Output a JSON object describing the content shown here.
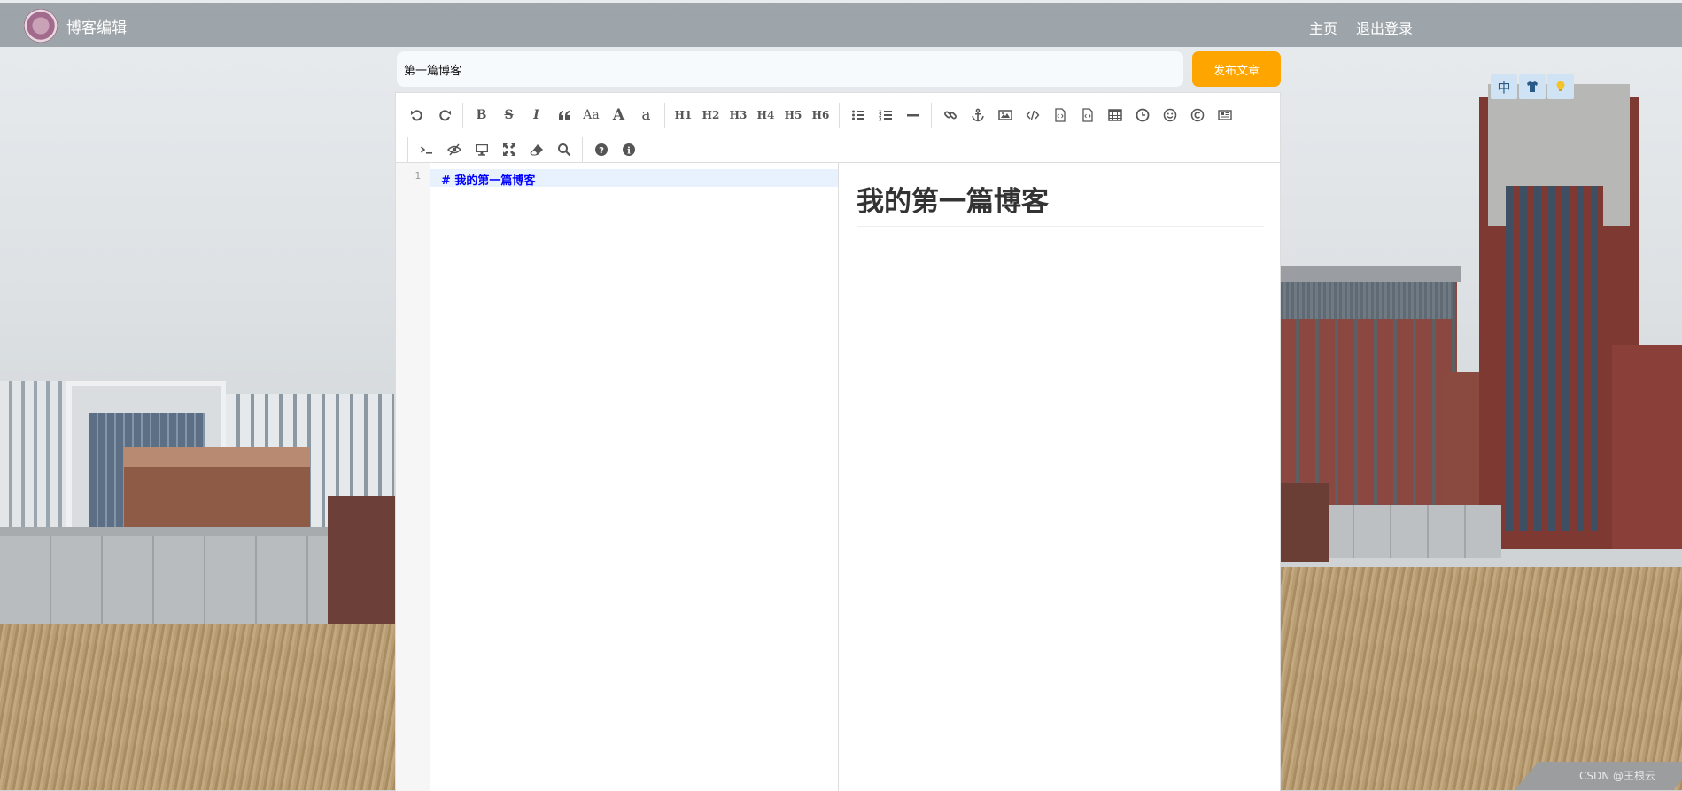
{
  "navbar": {
    "title": "博客编辑",
    "home_link": "主页",
    "logout_link": "退出登录"
  },
  "title_row": {
    "title_value": "第一篇博客",
    "publish_button": "发布文章"
  },
  "toolbar": {
    "row1": [
      {
        "name": "undo-icon",
        "glyph": "undo"
      },
      {
        "name": "redo-icon",
        "glyph": "redo"
      },
      {
        "sep": true
      },
      {
        "name": "bold-button",
        "label": "B"
      },
      {
        "name": "strikethrough-button",
        "label": "S"
      },
      {
        "name": "italic-button",
        "label": "I"
      },
      {
        "name": "quote-icon",
        "glyph": "quote"
      },
      {
        "name": "case-toggle-button",
        "label": "Aa"
      },
      {
        "name": "uppercase-button",
        "label": "A"
      },
      {
        "name": "lowercase-button",
        "label": "a"
      },
      {
        "sep": true
      },
      {
        "name": "h1-button",
        "label": "H1"
      },
      {
        "name": "h2-button",
        "label": "H2"
      },
      {
        "name": "h3-button",
        "label": "H3"
      },
      {
        "name": "h4-button",
        "label": "H4"
      },
      {
        "name": "h5-button",
        "label": "H5"
      },
      {
        "name": "h6-button",
        "label": "H6"
      },
      {
        "sep": true
      },
      {
        "name": "unordered-list-icon",
        "glyph": "ul"
      },
      {
        "name": "ordered-list-icon",
        "glyph": "ol"
      },
      {
        "name": "horizontal-rule-icon",
        "glyph": "hr"
      },
      {
        "sep": true
      },
      {
        "name": "link-icon",
        "glyph": "link"
      },
      {
        "name": "anchor-icon",
        "glyph": "anchor"
      },
      {
        "name": "image-icon",
        "glyph": "image"
      },
      {
        "name": "code-icon",
        "glyph": "code"
      },
      {
        "name": "code-block-icon",
        "glyph": "file"
      },
      {
        "name": "preformatted-icon",
        "glyph": "file"
      },
      {
        "name": "table-icon",
        "glyph": "table"
      },
      {
        "name": "datetime-icon",
        "glyph": "clock"
      },
      {
        "name": "emoji-icon",
        "glyph": "smile"
      },
      {
        "name": "html-entities-icon",
        "glyph": "copyright"
      },
      {
        "name": "pagebreak-icon",
        "glyph": "newspaper"
      }
    ],
    "row2": [
      {
        "sep": true
      },
      {
        "name": "goto-line-icon",
        "glyph": "terminal"
      },
      {
        "name": "watch-toggle-icon",
        "glyph": "eyeslash"
      },
      {
        "name": "preview-icon",
        "glyph": "desktop"
      },
      {
        "name": "fullscreen-icon",
        "glyph": "expand"
      },
      {
        "name": "clear-icon",
        "glyph": "eraser"
      },
      {
        "name": "search-icon",
        "glyph": "search"
      },
      {
        "sep": true
      },
      {
        "name": "help-icon",
        "glyph": "help"
      },
      {
        "name": "info-icon",
        "glyph": "info"
      }
    ]
  },
  "editor": {
    "line_number": "1",
    "code_line": "# 我的第一篇博客",
    "preview_heading": "我的第一篇博客"
  },
  "widget": {
    "lang_label": "中"
  },
  "watermark": "CSDN @王根云"
}
